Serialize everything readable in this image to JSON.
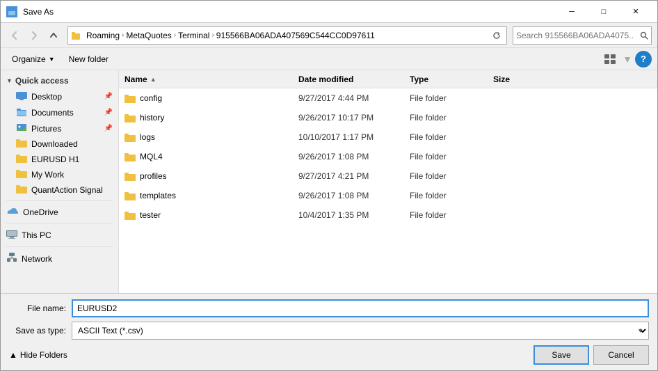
{
  "titleBar": {
    "title": "Save As",
    "closeLabel": "✕",
    "minimizeLabel": "─",
    "maximizeLabel": "□"
  },
  "addressBar": {
    "crumbs": [
      "Roaming",
      "MetaQuotes",
      "Terminal",
      "915566BA06ADA407569C544CC0D97611"
    ],
    "searchPlaceholder": "Search 915566BA06ADA4075..."
  },
  "toolbar2": {
    "organizeLabel": "Organize",
    "newFolderLabel": "New folder",
    "helpLabel": "?"
  },
  "sidebar": {
    "quickAccessLabel": "Quick access",
    "quickAccessChevron": "▼",
    "items": [
      {
        "id": "desktop",
        "label": "Desktop",
        "type": "special",
        "pinned": true
      },
      {
        "id": "documents",
        "label": "Documents",
        "type": "special",
        "pinned": true
      },
      {
        "id": "pictures",
        "label": "Pictures",
        "type": "special",
        "pinned": true
      },
      {
        "id": "downloaded",
        "label": "Downloaded",
        "type": "folder"
      },
      {
        "id": "eurusd",
        "label": "EURUSD H1",
        "type": "folder"
      },
      {
        "id": "mywork",
        "label": "My Work",
        "type": "folder"
      },
      {
        "id": "quantaction",
        "label": "QuantAction Signal",
        "type": "folder"
      }
    ],
    "onedrive": {
      "label": "OneDrive"
    },
    "thispc": {
      "label": "This PC"
    },
    "network": {
      "label": "Network"
    },
    "hideFoldersChevron": "▲",
    "hideFoldersLabel": "Hide Folders"
  },
  "fileList": {
    "columns": {
      "name": "Name",
      "dateModified": "Date modified",
      "type": "Type",
      "size": "Size"
    },
    "rows": [
      {
        "name": "config",
        "date": "9/27/2017 4:44 PM",
        "type": "File folder",
        "size": ""
      },
      {
        "name": "history",
        "date": "9/26/2017 10:17 PM",
        "type": "File folder",
        "size": ""
      },
      {
        "name": "logs",
        "date": "10/10/2017 1:17 PM",
        "type": "File folder",
        "size": ""
      },
      {
        "name": "MQL4",
        "date": "9/26/2017 1:08 PM",
        "type": "File folder",
        "size": ""
      },
      {
        "name": "profiles",
        "date": "9/27/2017 4:21 PM",
        "type": "File folder",
        "size": ""
      },
      {
        "name": "templates",
        "date": "9/26/2017 1:08 PM",
        "type": "File folder",
        "size": ""
      },
      {
        "name": "tester",
        "date": "10/4/2017 1:35 PM",
        "type": "File folder",
        "size": ""
      }
    ]
  },
  "bottomBar": {
    "fileNameLabel": "File name:",
    "fileNameValue": "EURUSD2",
    "saveAsTypeLabel": "Save as type:",
    "saveAsTypeValue": "ASCII Text (*.csv)",
    "saveLabel": "Save",
    "cancelLabel": "Cancel",
    "hideFoldersLabel": "Hide Folders"
  }
}
